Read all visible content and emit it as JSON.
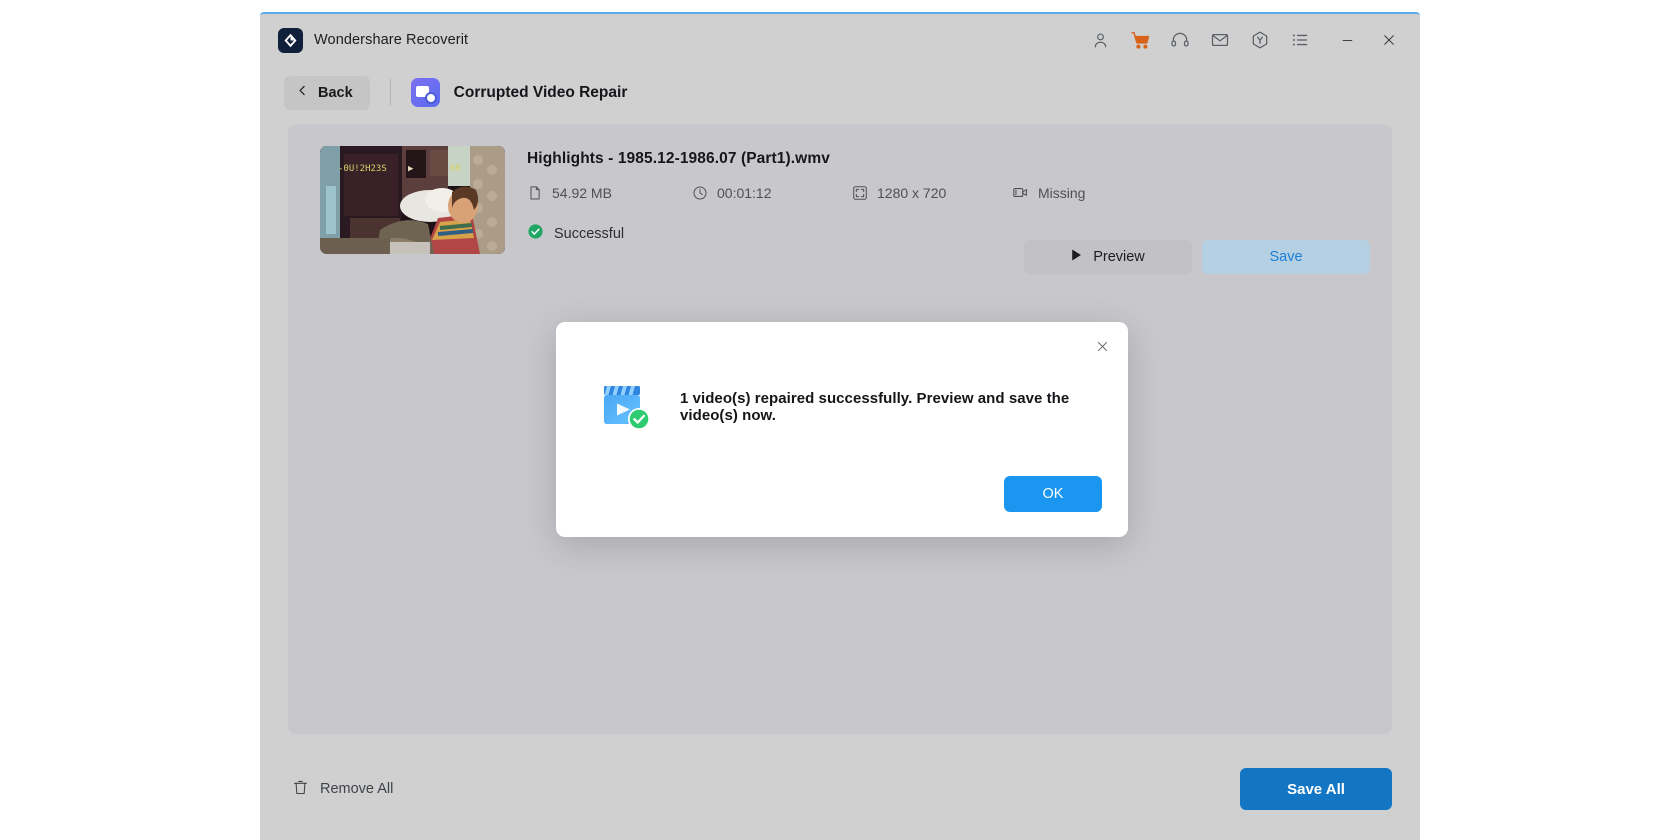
{
  "window": {
    "app_title": "Wondershare Recoverit",
    "logo_icon": "wondershare-diamond-logo",
    "toolbar_icons": [
      {
        "name": "account-icon",
        "label": "Account",
        "color": "#5b6066"
      },
      {
        "name": "cart-icon",
        "label": "Buy Now",
        "color": "#d9631b"
      },
      {
        "name": "support-headset-icon",
        "label": "Support",
        "color": "#5b6066"
      },
      {
        "name": "mail-icon",
        "label": "Messages",
        "color": "#5b6066"
      },
      {
        "name": "hexagon-upgrade-icon",
        "label": "Upgrade",
        "color": "#5b6066"
      },
      {
        "name": "menu-list-icon",
        "label": "Menu",
        "color": "#5b6066"
      }
    ],
    "minimize_label": "Minimize",
    "close_label": "Close"
  },
  "subheader": {
    "back_label": "Back",
    "back_icon": "chevron-left-icon",
    "feature_icon": "corrupted-video-repair-icon",
    "feature_title": "Corrupted Video Repair"
  },
  "file": {
    "name": "Highlights - 1985.12-1986.07 (Part1).wmv",
    "thumbnail_name": "video-thumbnail",
    "thumbnail_overlay_text": "-0U!2H23S  >        8R",
    "meta": [
      {
        "icon": "file-icon",
        "value": "54.92  MB"
      },
      {
        "icon": "clock-icon",
        "value": "00:01:12"
      },
      {
        "icon": "resolution-icon",
        "value": "1280 x 720"
      },
      {
        "icon": "camera-icon",
        "value": "Missing"
      }
    ],
    "status_icon": "check-circle-icon",
    "status_text": "Successful",
    "status_color": "#21a665",
    "preview_label": "Preview",
    "preview_icon": "play-icon",
    "save_label": "Save"
  },
  "bottom": {
    "remove_all_label": "Remove All",
    "remove_all_icon": "trash-icon",
    "save_all_label": "Save All"
  },
  "modal": {
    "close_icon": "close-icon",
    "icon_name": "video-repaired-success-icon",
    "message": "1 video(s) repaired successfully. Preview and save the video(s) now.",
    "ok_label": "OK"
  },
  "colors": {
    "accent_blue": "#1b96f0",
    "primary_blue": "#1276c4",
    "success_green": "#21a665",
    "cart_orange": "#d9631b",
    "window_chrome": "#d0d0d0",
    "panel": "#c8c8cc"
  }
}
